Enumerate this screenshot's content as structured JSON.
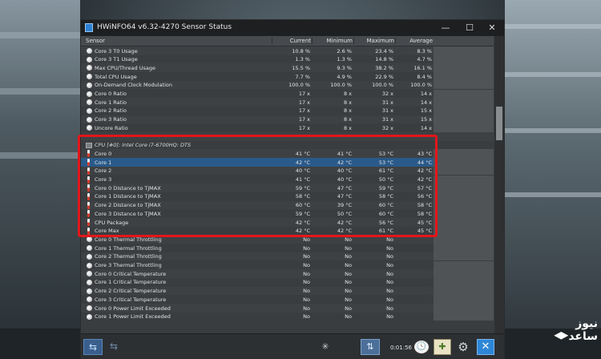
{
  "window": {
    "title": "HWiNFO64 v6.32-4270 Sensor Status",
    "min_label": "—",
    "max_label": "☐",
    "close_label": "✕"
  },
  "columns": {
    "sensor": "Sensor",
    "current": "Current",
    "minimum": "Minimum",
    "maximum": "Maximum",
    "average": "Average"
  },
  "rows": [
    {
      "icon": "gauge",
      "name": "Core 3 T0 Usage",
      "current": "10.8 %",
      "min": "2.6 %",
      "max": "23.4 %",
      "avg": "8.3 %"
    },
    {
      "icon": "gauge",
      "name": "Core 3 T1 Usage",
      "current": "1.3 %",
      "min": "1.3 %",
      "max": "14.8 %",
      "avg": "4.7 %"
    },
    {
      "icon": "gauge",
      "name": "Max CPU/Thread Usage",
      "current": "15.5 %",
      "min": "9.3 %",
      "max": "38.2 %",
      "avg": "16.1 %"
    },
    {
      "icon": "gauge",
      "name": "Total CPU Usage",
      "current": "7.7 %",
      "min": "4.9 %",
      "max": "22.9 %",
      "avg": "8.4 %"
    },
    {
      "icon": "gauge",
      "name": "On-Demand Clock Modulation",
      "current": "100.0 %",
      "min": "100.0 %",
      "max": "100.0 %",
      "avg": "100.0 %"
    },
    {
      "icon": "gauge",
      "name": "Core 0 Ratio",
      "current": "17 x",
      "min": "8 x",
      "max": "32 x",
      "avg": "14 x"
    },
    {
      "icon": "gauge",
      "name": "Core 1 Ratio",
      "current": "17 x",
      "min": "8 x",
      "max": "31 x",
      "avg": "14 x"
    },
    {
      "icon": "gauge",
      "name": "Core 2 Ratio",
      "current": "17 x",
      "min": "8 x",
      "max": "31 x",
      "avg": "15 x"
    },
    {
      "icon": "gauge",
      "name": "Core 3 Ratio",
      "current": "17 x",
      "min": "8 x",
      "max": "31 x",
      "avg": "15 x"
    },
    {
      "icon": "gauge",
      "name": "Uncore Ratio",
      "current": "17 x",
      "min": "8 x",
      "max": "32 x",
      "avg": "14 x"
    },
    {
      "icon": "none",
      "name": "",
      "current": "",
      "min": "",
      "max": "",
      "avg": "",
      "spacer": true
    },
    {
      "icon": "chip",
      "name": "CPU [#0]: Intel Core i7-6700HQ: DTS",
      "current": "",
      "min": "",
      "max": "",
      "avg": "",
      "group": true
    },
    {
      "icon": "temp",
      "name": "Core 0",
      "current": "41 °C",
      "min": "41 °C",
      "max": "53 °C",
      "avg": "43 °C"
    },
    {
      "icon": "temp",
      "name": "Core 1",
      "current": "42 °C",
      "min": "42 °C",
      "max": "53 °C",
      "avg": "44 °C",
      "selected": true
    },
    {
      "icon": "temp",
      "name": "Core 2",
      "current": "40 °C",
      "min": "40 °C",
      "max": "61 °C",
      "avg": "42 °C"
    },
    {
      "icon": "temp",
      "name": "Core 3",
      "current": "41 °C",
      "min": "40 °C",
      "max": "50 °C",
      "avg": "42 °C"
    },
    {
      "icon": "temp",
      "name": "Core 0 Distance to TjMAX",
      "current": "59 °C",
      "min": "47 °C",
      "max": "59 °C",
      "avg": "57 °C"
    },
    {
      "icon": "temp",
      "name": "Core 1 Distance to TjMAX",
      "current": "58 °C",
      "min": "47 °C",
      "max": "58 °C",
      "avg": "56 °C"
    },
    {
      "icon": "temp",
      "name": "Core 2 Distance to TjMAX",
      "current": "60 °C",
      "min": "39 °C",
      "max": "60 °C",
      "avg": "58 °C"
    },
    {
      "icon": "temp",
      "name": "Core 3 Distance to TjMAX",
      "current": "59 °C",
      "min": "50 °C",
      "max": "60 °C",
      "avg": "58 °C"
    },
    {
      "icon": "temp",
      "name": "CPU Package",
      "current": "42 °C",
      "min": "42 °C",
      "max": "56 °C",
      "avg": "45 °C"
    },
    {
      "icon": "temp",
      "name": "Core Max",
      "current": "42 °C",
      "min": "42 °C",
      "max": "61 °C",
      "avg": "45 °C"
    },
    {
      "icon": "gauge",
      "name": "Core 0 Thermal Throttling",
      "current": "No",
      "min": "No",
      "max": "No",
      "avg": ""
    },
    {
      "icon": "gauge",
      "name": "Core 1 Thermal Throttling",
      "current": "No",
      "min": "No",
      "max": "No",
      "avg": ""
    },
    {
      "icon": "gauge",
      "name": "Core 2 Thermal Throttling",
      "current": "No",
      "min": "No",
      "max": "No",
      "avg": ""
    },
    {
      "icon": "gauge",
      "name": "Core 3 Thermal Throttling",
      "current": "No",
      "min": "No",
      "max": "No",
      "avg": ""
    },
    {
      "icon": "gauge",
      "name": "Core 0 Critical Temperature",
      "current": "No",
      "min": "No",
      "max": "No",
      "avg": ""
    },
    {
      "icon": "gauge",
      "name": "Core 1 Critical Temperature",
      "current": "No",
      "min": "No",
      "max": "No",
      "avg": ""
    },
    {
      "icon": "gauge",
      "name": "Core 2 Critical Temperature",
      "current": "No",
      "min": "No",
      "max": "No",
      "avg": ""
    },
    {
      "icon": "gauge",
      "name": "Core 3 Critical Temperature",
      "current": "No",
      "min": "No",
      "max": "No",
      "avg": ""
    },
    {
      "icon": "gauge",
      "name": "Core 0 Power Limit Exceeded",
      "current": "No",
      "min": "No",
      "max": "No",
      "avg": ""
    },
    {
      "icon": "gauge",
      "name": "Core 1 Power Limit Exceeded",
      "current": "No",
      "min": "No",
      "max": "No",
      "avg": ""
    }
  ],
  "footer": {
    "nav_left_icon": "⇆",
    "nav_right_icon": "⇆",
    "burst_icon": "✳",
    "network_icon": "⇅",
    "timer": "0:01:56",
    "clock_icon": "🕓",
    "report_icon": "✚",
    "settings_icon": "⚙",
    "close_icon": "✕"
  },
  "watermark": {
    "line1": "نیوز",
    "line2": "ساعد"
  },
  "colors": {
    "highlight": "#e3161a",
    "selected_row": "#2a5a8a"
  }
}
